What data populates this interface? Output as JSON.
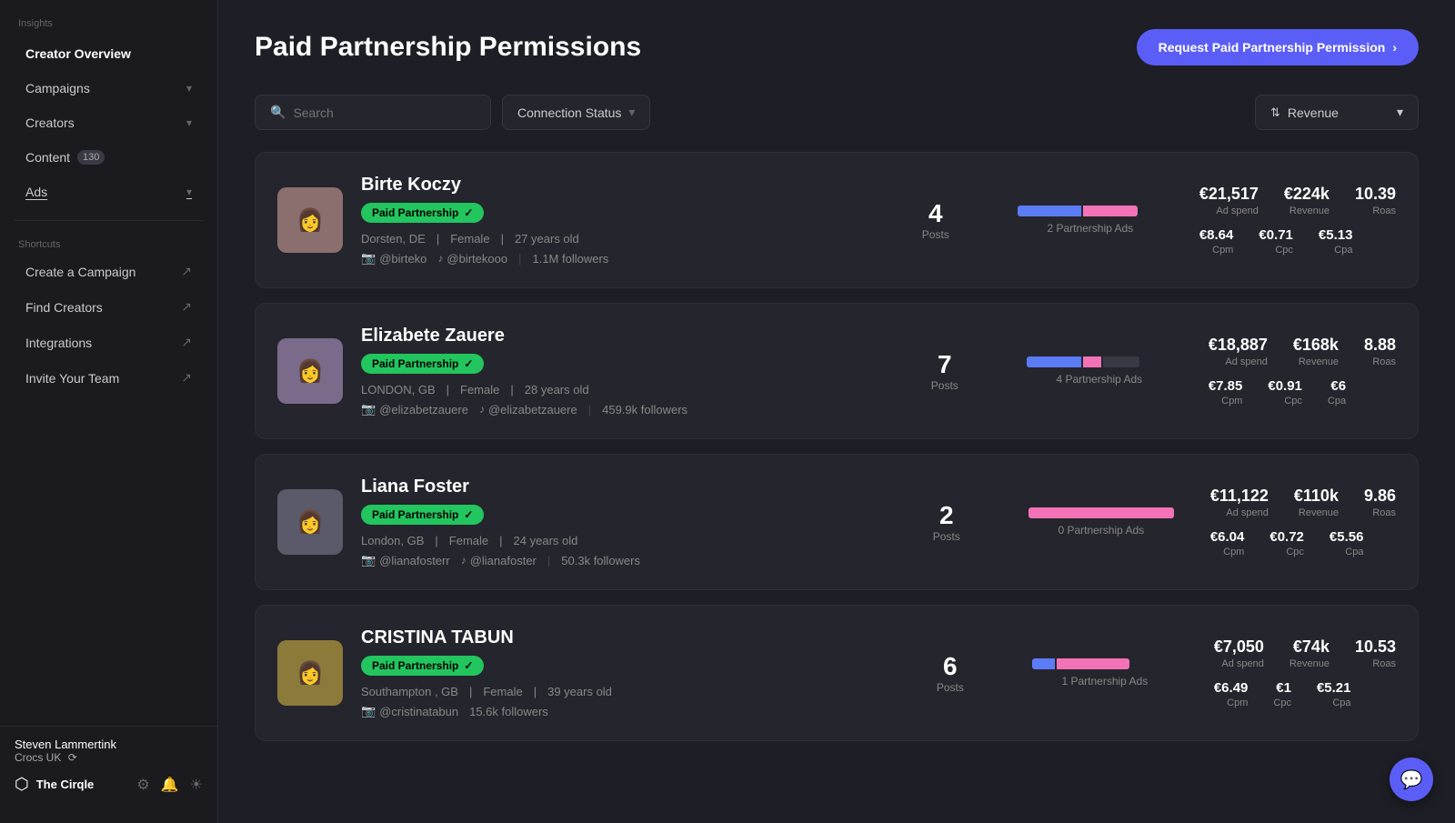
{
  "sidebar": {
    "insights_label": "Insights",
    "creator_overview": "Creator Overview",
    "campaigns": "Campaigns",
    "creators": "Creators",
    "content": "Content",
    "content_badge": "130",
    "ads": "Ads",
    "shortcuts_label": "Shortcuts",
    "create_campaign": "Create a Campaign",
    "find_creators": "Find Creators",
    "integrations": "Integrations",
    "invite_team": "Invite Your Team",
    "user_name": "Steven Lammertink",
    "user_org": "Crocs UK",
    "logo_text": "The Cirqle"
  },
  "page": {
    "title": "Paid Partnership Permissions",
    "request_btn": "Request Paid Partnership Permission"
  },
  "filters": {
    "search_placeholder": "Search",
    "connection_status": "Connection Status",
    "sort_label": "Revenue"
  },
  "creators": [
    {
      "name": "Birte Koczy",
      "location": "Dorsten, DE",
      "gender": "Female",
      "age": "27 years old",
      "ig_handle": "@birteko",
      "tt_handle": "@birtekooo",
      "followers": "1.1M followers",
      "posts": 4,
      "partnership_ads_count": 2,
      "partnership_ads_label": "2 Partnership Ads",
      "bar_blue_w": 70,
      "bar_pink_w": 60,
      "bar_gray_w": 0,
      "bar_type": "blue_pink",
      "ad_spend": "€21,517",
      "revenue": "€224k",
      "roas": "10.39",
      "cpm": "€8.64",
      "cpc": "€0.71",
      "cpa": "€5.13",
      "avatar_color": "#8B6F6F",
      "avatar_emoji": "👩"
    },
    {
      "name": "Elizabete Zauere",
      "location": "LONDON, GB",
      "gender": "Female",
      "age": "28 years old",
      "ig_handle": "@elizabetzauere",
      "tt_handle": "@elizabetzauere",
      "followers": "459.9k followers",
      "posts": 7,
      "partnership_ads_count": 4,
      "partnership_ads_label": "4 Partnership Ads",
      "bar_blue_w": 60,
      "bar_pink_w": 20,
      "bar_gray_w": 40,
      "bar_type": "blue_pink_gray",
      "ad_spend": "€18,887",
      "revenue": "€168k",
      "roas": "8.88",
      "cpm": "€7.85",
      "cpc": "€0.91",
      "cpa": "€6",
      "avatar_color": "#7A6B8A",
      "avatar_emoji": "👩"
    },
    {
      "name": "Liana Foster",
      "location": "London, GB",
      "gender": "Female",
      "age": "24 years old",
      "ig_handle": "@lianafosterr",
      "tt_handle": "@lianafoster",
      "followers": "50.3k followers",
      "posts": 2,
      "partnership_ads_count": 0,
      "partnership_ads_label": "0 Partnership Ads",
      "bar_blue_w": 0,
      "bar_pink_w": 140,
      "bar_gray_w": 0,
      "bar_type": "pink_full",
      "ad_spend": "€11,122",
      "revenue": "€110k",
      "roas": "9.86",
      "cpm": "€6.04",
      "cpc": "€0.72",
      "cpa": "€5.56",
      "avatar_color": "#5a5a6a",
      "avatar_emoji": "👩"
    },
    {
      "name": "CRISTINA TABUN",
      "location": "Southampton , GB",
      "gender": "Female",
      "age": "39 years old",
      "ig_handle": "@cristinatabun",
      "tt_handle": "",
      "followers": "15.6k followers",
      "posts": 6,
      "partnership_ads_count": 1,
      "partnership_ads_label": "1 Partnership Ads",
      "bar_blue_w": 25,
      "bar_pink_w": 80,
      "bar_gray_w": 0,
      "bar_type": "blue_pink",
      "ad_spend": "€7,050",
      "revenue": "€74k",
      "roas": "10.53",
      "cpm": "€6.49",
      "cpc": "€1",
      "cpa": "€5.21",
      "avatar_color": "#8B7A3A",
      "avatar_emoji": "👩"
    }
  ]
}
